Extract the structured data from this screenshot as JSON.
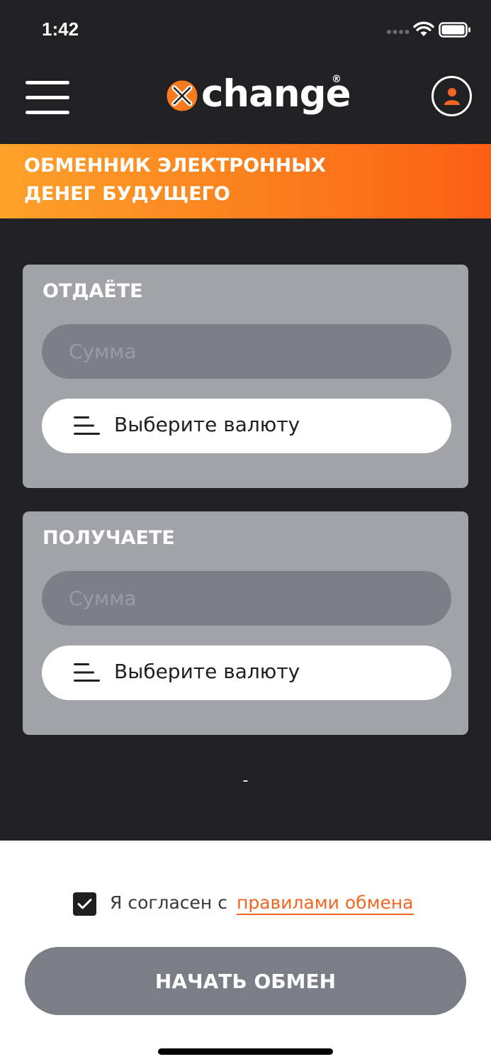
{
  "status_bar": {
    "time": "1:42"
  },
  "header": {
    "logo_text": "change",
    "logo_registered": "®"
  },
  "banner": {
    "line1": "ОБМЕННИК ЭЛЕКТРОННЫХ",
    "line2": "ДЕНЕГ БУДУЩЕГО"
  },
  "give_card": {
    "title": "ОТДАЁТЕ",
    "amount_placeholder": "Сумма",
    "currency_label": "Выберите валюту"
  },
  "receive_card": {
    "title": "ПОЛУЧАЕТЕ",
    "amount_placeholder": "Сумма",
    "currency_label": "Выберите валюту"
  },
  "rate": "-",
  "agreement": {
    "checked": true,
    "text": "Я согласен с",
    "link": "правилами обмена"
  },
  "start_button": "НАЧАТЬ ОБМЕН",
  "colors": {
    "accent": "#fb7e1d",
    "background": "#212123",
    "card": "#a1a3a9",
    "input": "#7c7f88",
    "link": "#f26522"
  }
}
